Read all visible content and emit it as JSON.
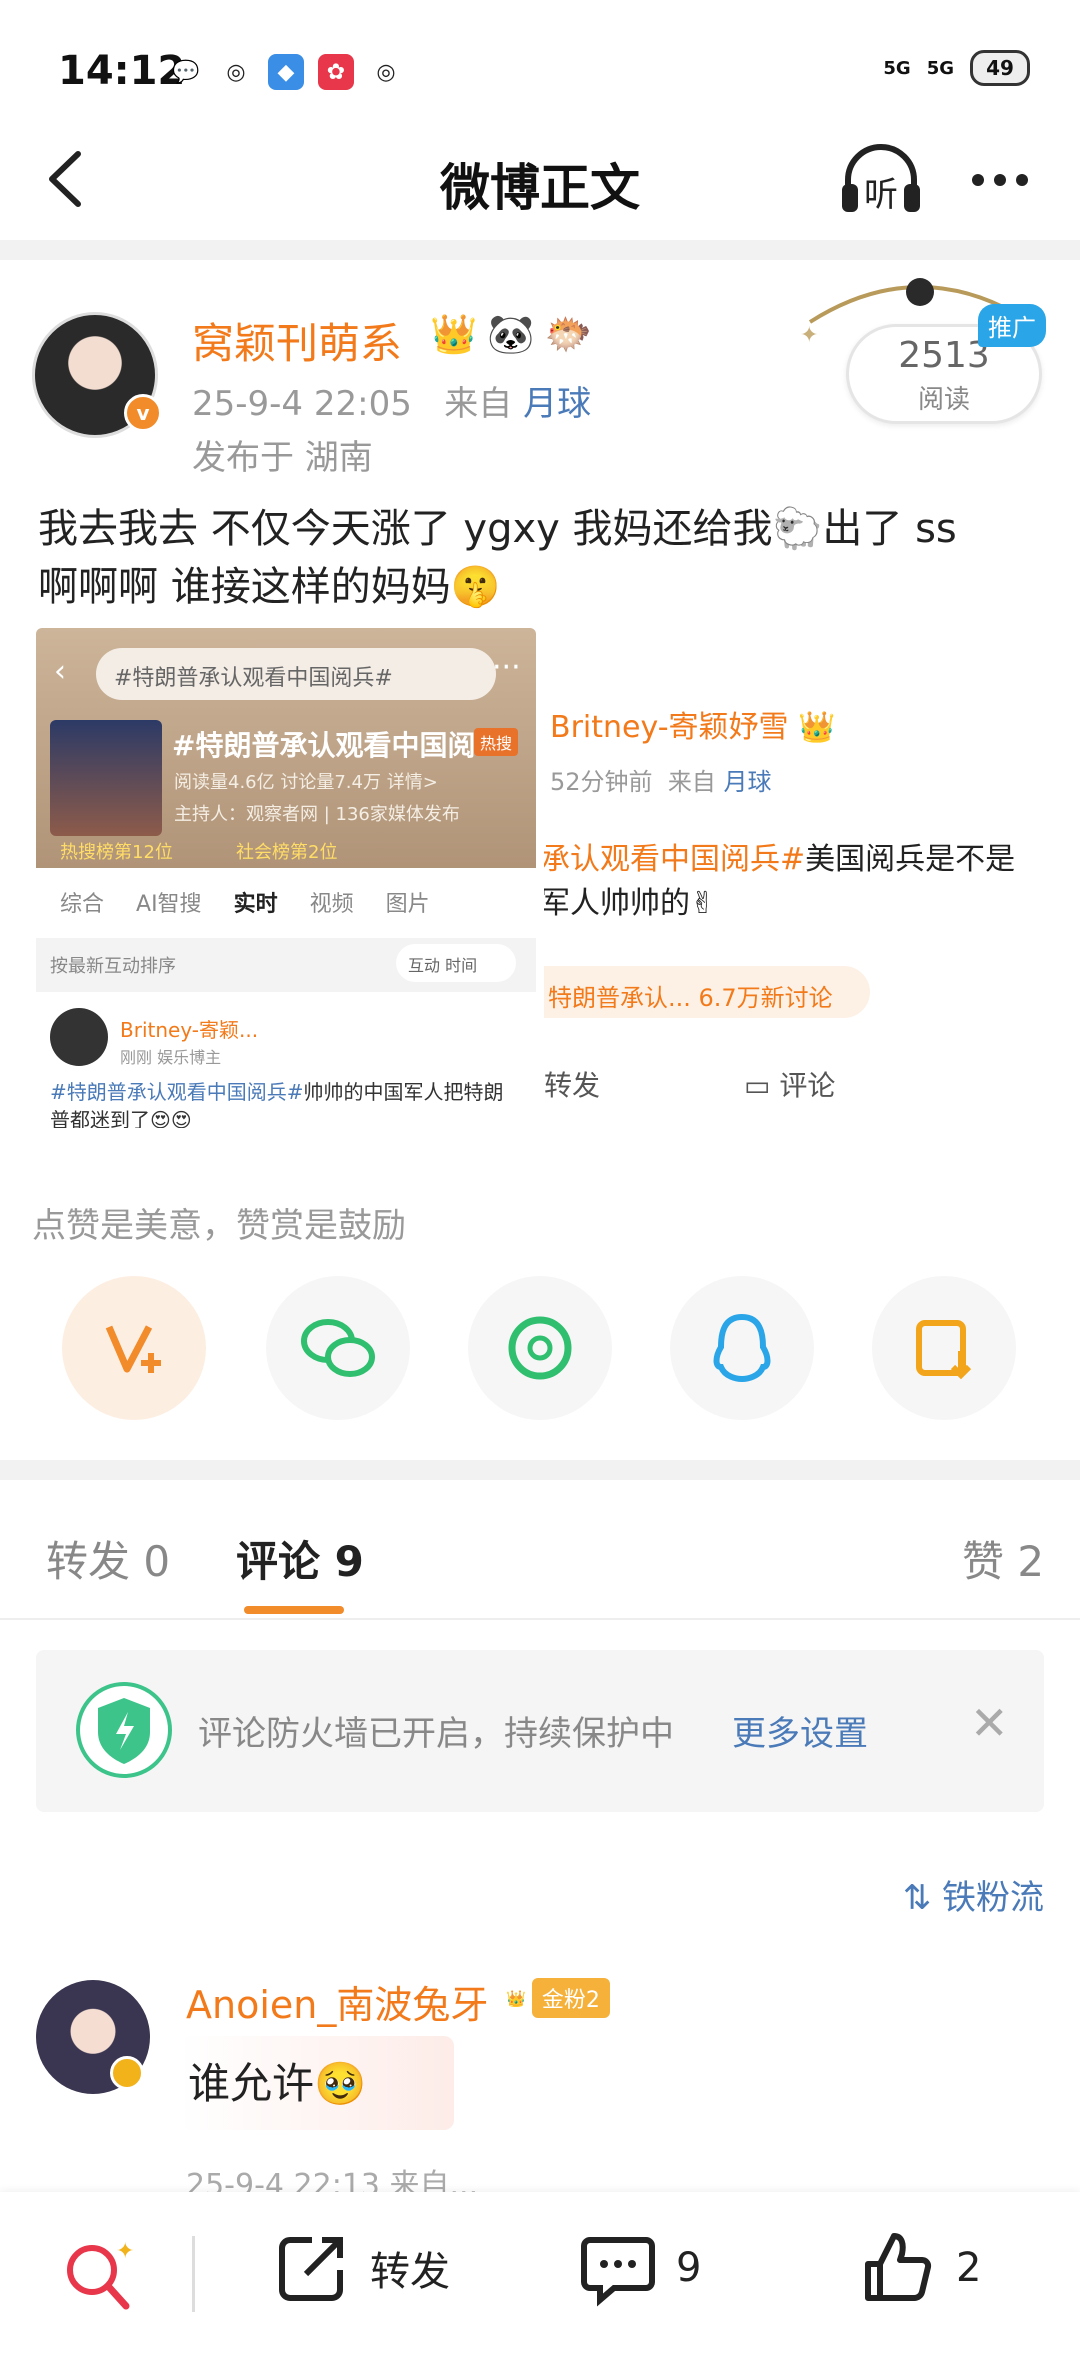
{
  "status_bar": {
    "time": "14:12",
    "net1": "5G",
    "net2": "5G",
    "battery": "49"
  },
  "nav": {
    "title": "微博正文",
    "listen_label": "听"
  },
  "post": {
    "author": "窝颖刊萌系",
    "time": "25-9-4 22:05",
    "from_prefix": "来自",
    "source": "月球",
    "location": "发布于 湖南",
    "reads": "2513",
    "reads_label": "阅读",
    "promo": "推广",
    "text_line1": "我去我去 不仅今天涨了 ygxy 我妈还给我🐑出了 ss",
    "text_line2": "啊啊啊 谁接这样的妈妈🤫"
  },
  "image_left": {
    "search": "#特朗普承认观看中国阅兵#",
    "topic": "#特朗普承认观看中国阅...",
    "hot": "热搜",
    "stats": "阅读量4.6亿  讨论量7.4万  详情>",
    "host": "主持人：观察者网 | 136家媒体发布",
    "rank1": "热搜榜第12位",
    "rank2": "社会榜第2位",
    "tabs": [
      "综合",
      "AI智搜",
      "实时",
      "视频",
      "图片"
    ],
    "sort": "按最新互动排序",
    "sort_pill": "互动  时间",
    "user": "Britney-寄颖...",
    "user_meta": "刚刚  娱乐博主",
    "text_hash": "#特朗普承认观看中国阅兵#",
    "text_body": "帅帅的中国军人把特朗普都迷到了😍😍"
  },
  "image_right": {
    "author": "Britney-寄颖妤雪",
    "meta": "52分钟前",
    "from_prefix": "来自",
    "source": "月球",
    "text_hash": "承认观看中国阅兵#",
    "text_body": "美国阅兵是不是",
    "text_line2": "军人帅帅的✌",
    "tag": "特朗普承认... 6.7万新讨论",
    "fwd": "转发",
    "cmt": "评论"
  },
  "tip": "点赞是美意，赞赏是鼓励",
  "share": [
    "v-plus-icon",
    "wechat-icon",
    "moments-icon",
    "qq-icon",
    "save-image-icon"
  ],
  "tabs": {
    "repost": "转发 0",
    "comment": "评论 9",
    "like": "赞 2"
  },
  "firewall": {
    "text": "评论防火墙已开启，持续保护中",
    "link": "更多设置"
  },
  "sort_label": "⇅ 铁粉流",
  "comment": {
    "name": "Anoien_南波兔牙",
    "fan_level": "金粉2",
    "text": "谁允许🥹",
    "meta": "25-9-4 22:13 来自..."
  },
  "bottom": {
    "repost": "转发",
    "comment_count": "9",
    "like_count": "2"
  },
  "colors": {
    "accent": "#f27a1a",
    "link": "#4a7ab8",
    "orange_bar": "#f28b2a"
  }
}
